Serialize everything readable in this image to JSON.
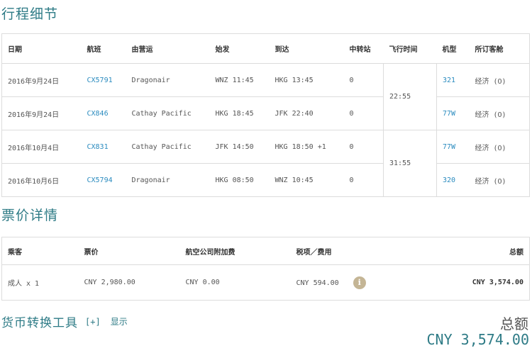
{
  "itinerary": {
    "title": "行程细节",
    "headers": [
      "日期",
      "航班",
      "由营运",
      "始发",
      "到达",
      "中转站",
      "飞行时间",
      "机型",
      "所订客舱"
    ],
    "rows": [
      {
        "date": "2016年9月24日",
        "flight": "CX5791",
        "operator": "Dragonair",
        "origin": "WNZ 11:45",
        "dest": "HKG 13:45",
        "stops": "0",
        "aircraft": "321",
        "cabin": "经济 (O)"
      },
      {
        "date": "2016年9月24日",
        "flight": "CX846",
        "operator": "Cathay Pacific",
        "origin": "HKG 18:45",
        "dest": "JFK 22:40",
        "stops": "0",
        "aircraft": "77W",
        "cabin": "经济 (O)"
      },
      {
        "date": "2016年10月4日",
        "flight": "CX831",
        "operator": "Cathay Pacific",
        "origin": "JFK 14:50",
        "dest": "HKG 18:50 +1",
        "stops": "0",
        "aircraft": "77W",
        "cabin": "经济 (O)"
      },
      {
        "date": "2016年10月6日",
        "flight": "CX5794",
        "operator": "Dragonair",
        "origin": "HKG 08:50",
        "dest": "WNZ 10:45",
        "stops": "0",
        "aircraft": "320",
        "cabin": "经济 (O)"
      }
    ],
    "durations": [
      "22:55",
      "31:55"
    ]
  },
  "fare": {
    "title": "票价详情",
    "headers": [
      "乘客",
      "票价",
      "航空公司附加费",
      "税项／费用",
      "总额"
    ],
    "row": {
      "passenger": "成人 x 1",
      "fare": "CNY 2,980.00",
      "surcharge": "CNY 0.00",
      "taxes": "CNY 594.00",
      "info_icon": "i",
      "total": "CNY 3,574.00"
    }
  },
  "currency": {
    "title": "货币转换工具",
    "toggle": "[+]",
    "show": "显示"
  },
  "total": {
    "label": "总额",
    "amount": "CNY 3,574.00"
  },
  "colors": {
    "accent": "#2e7b86",
    "link": "#2a8bbf",
    "info_icon_bg": "#c4b595",
    "border": "#dcdcdc"
  }
}
